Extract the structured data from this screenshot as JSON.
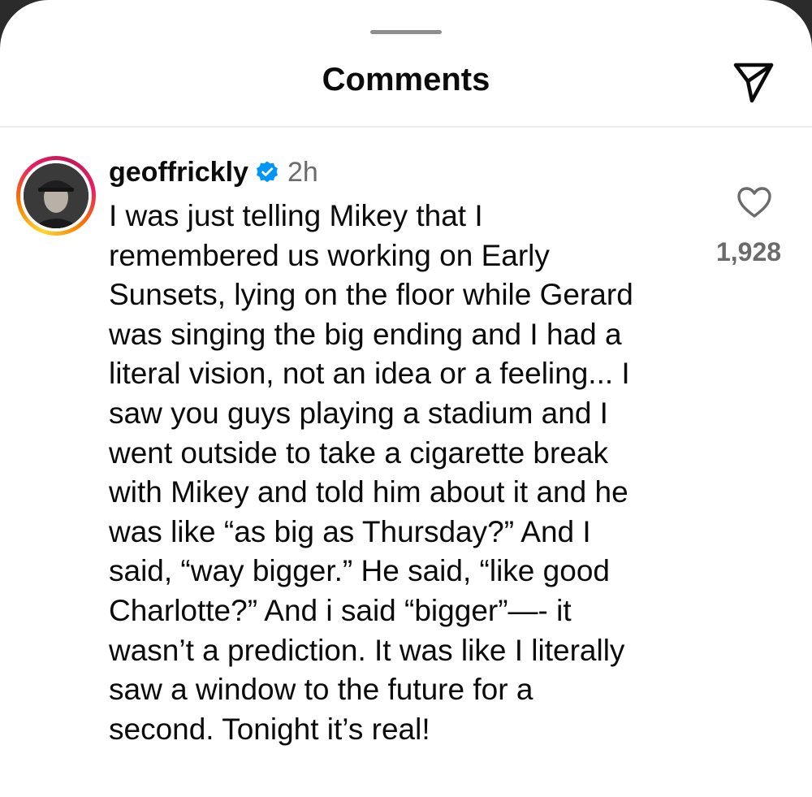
{
  "header": {
    "title": "Comments",
    "share_icon": "paper-plane-icon"
  },
  "comment": {
    "username": "geoffrickly",
    "verified_icon": "verified-badge-icon",
    "time": "2h",
    "text": "I was just telling Mikey that I\nremembered us working on Early\nSunsets, lying on the floor while Gerard\nwas singing the big ending and I had a\nliteral vision, not an idea or a feeling... I\nsaw you guys playing a stadium and I\nwent outside to take a cigarette break\nwith Mikey and told him about it and he\nwas like “as big as Thursday?” And I\nsaid, “way bigger.” He said, “like good\nCharlotte?” And i said “bigger”—- it\nwasn’t a prediction. It was like I literally\nsaw a window to the future for a\nsecond. Tonight it’s real!",
    "like_icon": "heart-outline-icon",
    "like_count": "1,928"
  },
  "colors": {
    "verified_blue": "#0095f6",
    "secondary_text": "#6b6b6b",
    "ring_gradient": [
      "#fdd835",
      "#f57c00",
      "#e91e63"
    ]
  }
}
